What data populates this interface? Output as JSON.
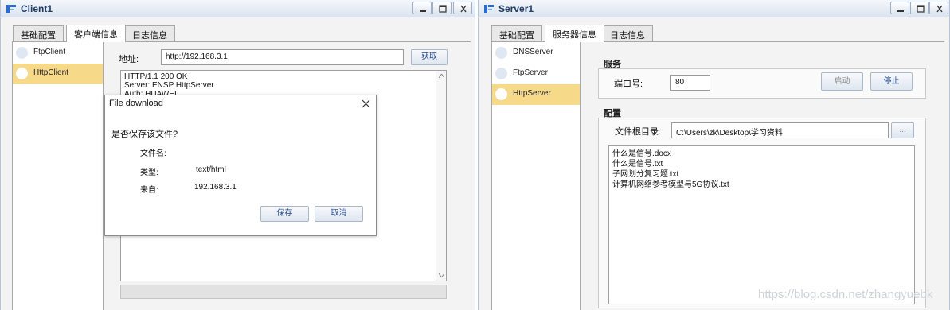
{
  "client": {
    "title": "Client1",
    "tabs": [
      "基础配置",
      "客户端信息",
      "日志信息"
    ],
    "sidebar": [
      {
        "label": "FtpClient",
        "selected": false
      },
      {
        "label": "HttpClient",
        "selected": true
      }
    ],
    "address_label": "地址:",
    "address_value": "http://192.168.3.1",
    "fetch_button": "获取",
    "response_lines": [
      "HTTP/1.1 200 OK",
      "Server: ENSP HttpServer",
      "Auth: HUAWEI"
    ]
  },
  "dialog": {
    "title": "File download",
    "prompt": "是否保存该文件?",
    "filename_label": "文件名:",
    "filename_value": "",
    "type_label": "类型:",
    "type_value": "text/html",
    "from_label": "来自:",
    "from_value": "192.168.3.1",
    "save_button": "保存",
    "cancel_button": "取消"
  },
  "server": {
    "title": "Server1",
    "tabs": [
      "基础配置",
      "服务器信息",
      "日志信息"
    ],
    "sidebar": [
      {
        "label": "DNSServer",
        "selected": false
      },
      {
        "label": "FtpServer",
        "selected": false
      },
      {
        "label": "HttpServer",
        "selected": true
      }
    ],
    "service_group": "服务",
    "port_label": "端口号:",
    "port_value": "80",
    "start_button": "启动",
    "stop_button": "停止",
    "config_group": "配置",
    "root_label": "文件根目录:",
    "root_value": "C:\\Users\\zk\\Desktop\\学习资料",
    "browse_button": "...",
    "files": [
      "什么是信号.docx",
      "什么是信号.txt",
      "子网划分复习题.txt",
      "计算机网络参考模型与5G协议.txt"
    ]
  },
  "watermark": "https://blog.csdn.net/zhangyuebk",
  "colors": {
    "selected_item": "#f7d98a",
    "titlebar": "#dbe4ef",
    "title_text": "#1f3c66"
  }
}
